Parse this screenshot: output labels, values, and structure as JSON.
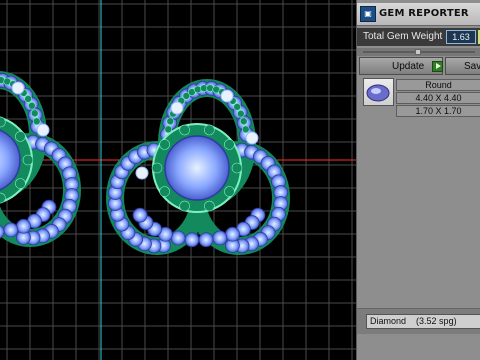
{
  "viewport": {
    "name": "3D model viewport",
    "colors": {
      "background": "#000000",
      "grid": "#4a4a4a",
      "axis_red": "#ff2a2a",
      "axis_cyan": "#2ad0e0",
      "metal_green": "#138a5e",
      "metal_highlight": "#7ef0c0",
      "gem_blue": "#8aa8ff",
      "gem_core": "#e8f2ff"
    }
  },
  "panel": {
    "title": "GEM REPORTER",
    "logo_icon": "gem-reporter-logo-icon",
    "total_weight": {
      "label": "Total Gem Weight",
      "value": "1.63"
    },
    "buttons": {
      "update": "Update",
      "save": "Save"
    },
    "gems": [
      {
        "shape": "Round",
        "size": "4.40 X 4.40",
        "depth": "1.70 X 1.70",
        "icon": "round-gem-icon"
      }
    ],
    "footer": {
      "material": "Diamond",
      "spg": "(3.52 spg)"
    }
  }
}
